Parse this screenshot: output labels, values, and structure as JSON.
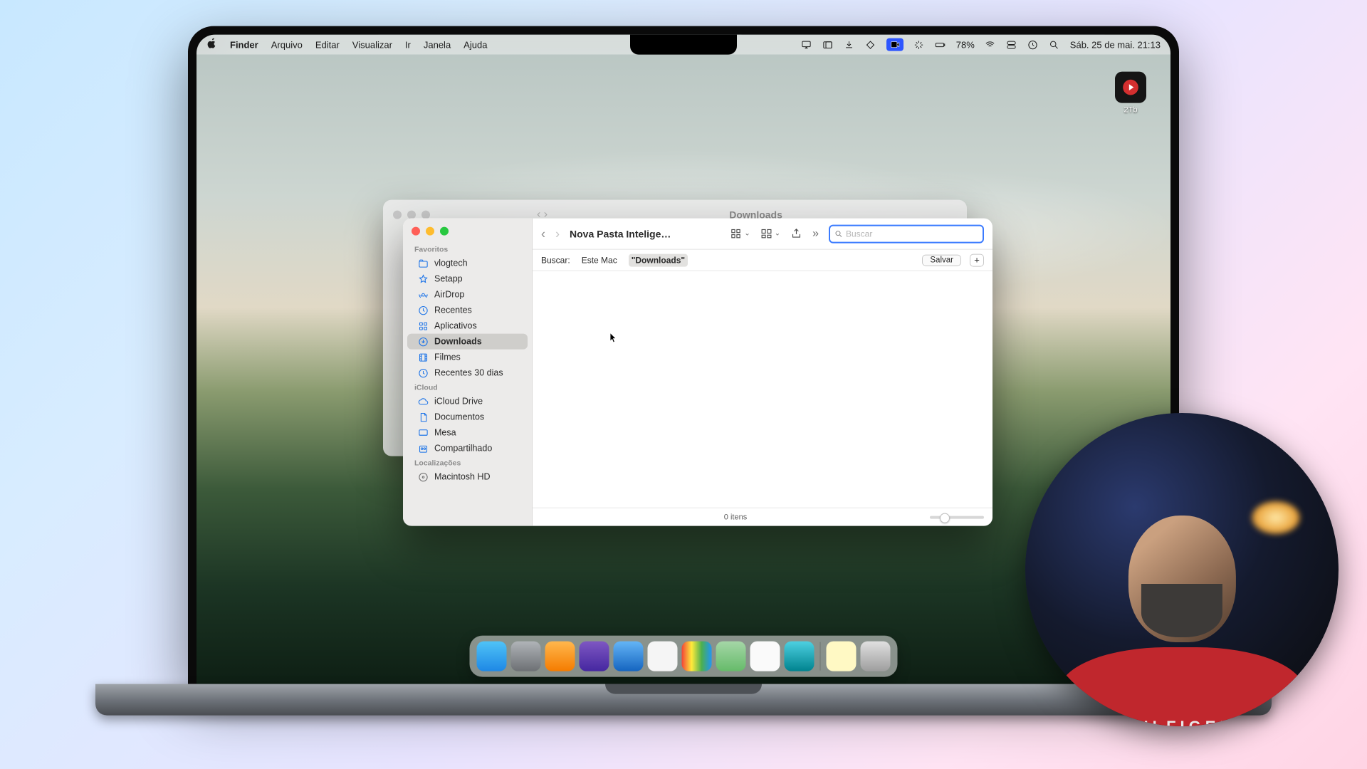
{
  "menubar": {
    "app": "Finder",
    "items": [
      "Arquivo",
      "Editar",
      "Visualizar",
      "Ir",
      "Janela",
      "Ajuda"
    ],
    "battery_pct": "78%",
    "datetime": "Sáb. 25 de mai.  21:13"
  },
  "desktop_icon": {
    "label": "2Tb"
  },
  "finder_back": {
    "title": "Downloads"
  },
  "finder": {
    "title": "Nova Pasta Intelige…",
    "search_placeholder": "Buscar",
    "scope_label": "Buscar:",
    "scope_mac": "Este Mac",
    "scope_downloads": "\"Downloads\"",
    "save_label": "Salvar",
    "status_items": "0 itens"
  },
  "sidebar": {
    "sections": {
      "favoritos": "Favoritos",
      "icloud": "iCloud",
      "localizacoes": "Localizações"
    },
    "fav": [
      {
        "label": "vlogtech",
        "icon": "folder"
      },
      {
        "label": "Setapp",
        "icon": "star"
      },
      {
        "label": "AirDrop",
        "icon": "airdrop"
      },
      {
        "label": "Recentes",
        "icon": "clock"
      },
      {
        "label": "Aplicativos",
        "icon": "apps"
      },
      {
        "label": "Downloads",
        "icon": "download",
        "selected": true
      },
      {
        "label": "Filmes",
        "icon": "film"
      },
      {
        "label": "Recentes 30 dias",
        "icon": "clock"
      }
    ],
    "icloud": [
      {
        "label": "iCloud Drive",
        "icon": "cloud"
      },
      {
        "label": "Documentos",
        "icon": "doc"
      },
      {
        "label": "Mesa",
        "icon": "desk"
      },
      {
        "label": "Compartilhado",
        "icon": "share"
      }
    ],
    "loc": [
      {
        "label": "Macintosh HD",
        "icon": "disk"
      }
    ]
  },
  "dock": {
    "apps": [
      {
        "name": "finder",
        "bg": "linear-gradient(#4fc3f7,#1e88e5)"
      },
      {
        "name": "settings",
        "bg": "linear-gradient(#b0b4b8,#6d7074)"
      },
      {
        "name": "appstore",
        "bg": "linear-gradient(#ffb74d,#f57c00)"
      },
      {
        "name": "arc",
        "bg": "linear-gradient(#7e57c2,#4527a0)"
      },
      {
        "name": "safari",
        "bg": "linear-gradient(#64b5f6,#1565c0)"
      },
      {
        "name": "notion",
        "bg": "#f5f5f5"
      },
      {
        "name": "colors",
        "bg": "linear-gradient(90deg,#f44336,#ffeb3b,#4caf50,#2196f3)"
      },
      {
        "name": "maps",
        "bg": "linear-gradient(#a5d6a7,#66bb6a)"
      },
      {
        "name": "photos",
        "bg": "#fafafa"
      },
      {
        "name": "preview",
        "bg": "linear-gradient(#4dd0e1,#00838f)"
      }
    ],
    "right": [
      {
        "name": "notes",
        "bg": "#fff9c4"
      },
      {
        "name": "trash",
        "bg": "linear-gradient(#e0e0e0,#9e9e9e)"
      }
    ]
  }
}
